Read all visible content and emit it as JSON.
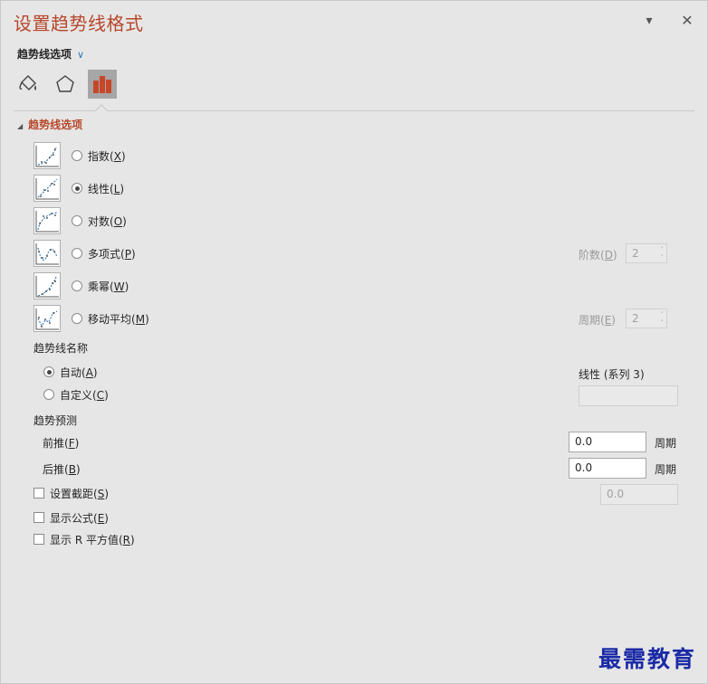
{
  "header": {
    "title": "设置趋势线格式",
    "dropdown_icon": "▾",
    "close_icon": "✕"
  },
  "section_selector": {
    "label": "趋势线选项",
    "chevron": "﹀"
  },
  "tabs": [
    {
      "name": "fill-line",
      "icon": "paint-bucket-icon"
    },
    {
      "name": "effects",
      "icon": "pentagon-icon"
    },
    {
      "name": "trendline-options",
      "icon": "bar-chart-icon",
      "active": true
    }
  ],
  "group": {
    "label": "趋势线选项",
    "expanded_icon": "◢"
  },
  "types": [
    {
      "label": "指数",
      "key": "X",
      "selected": false
    },
    {
      "label": "线性",
      "key": "L",
      "selected": true
    },
    {
      "label": "对数",
      "key": "O",
      "selected": false
    },
    {
      "label": "多项式",
      "key": "P",
      "selected": false
    },
    {
      "label": "乘幂",
      "key": "W",
      "selected": false
    },
    {
      "label": "移动平均",
      "key": "M",
      "selected": false
    }
  ],
  "order": {
    "label": "阶数",
    "key": "D",
    "value": "2"
  },
  "period": {
    "label": "周期",
    "key": "E",
    "value": "2"
  },
  "name_section": {
    "title": "趋势线名称",
    "auto": {
      "label": "自动",
      "key": "A",
      "selected": true
    },
    "custom": {
      "label": "自定义",
      "key": "C",
      "selected": false
    },
    "auto_value": "线性 (系列 3)",
    "custom_value": ""
  },
  "forecast": {
    "title": "趋势预测",
    "forward": {
      "label": "前推",
      "key": "F",
      "value": "0.0",
      "unit": "周期"
    },
    "backward": {
      "label": "后推",
      "key": "B",
      "value": "0.0",
      "unit": "周期"
    }
  },
  "options": {
    "intercept": {
      "label": "设置截距",
      "key": "S",
      "checked": false,
      "value": "0.0"
    },
    "equation": {
      "label": "显示公式",
      "key": "E",
      "checked": false
    },
    "rsquared": {
      "label": "显示 R 平方值",
      "key": "R",
      "checked": false
    }
  },
  "watermark": "最需教育"
}
